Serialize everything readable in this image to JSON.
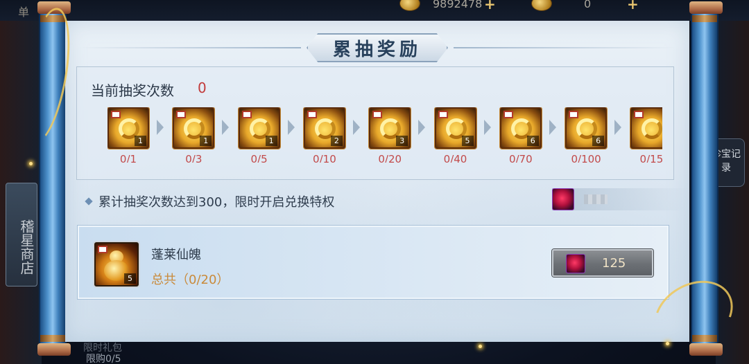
{
  "background": {
    "top_left_text": "单",
    "gold_amount": "9892478",
    "gem_amount": "0",
    "shop_label": "稽星商店",
    "side_button_label": "珍宝记录",
    "limited_label": "限时礼包",
    "limited_count": "限购0/5"
  },
  "dialog": {
    "title": "累抽奖励",
    "draw_count_label": "当前抽奖次数",
    "draw_count_value": "0",
    "milestones": [
      {
        "qty": "1",
        "progress": "0/1"
      },
      {
        "qty": "1",
        "progress": "0/3"
      },
      {
        "qty": "1",
        "progress": "0/5"
      },
      {
        "qty": "2",
        "progress": "0/10"
      },
      {
        "qty": "3",
        "progress": "0/20"
      },
      {
        "qty": "5",
        "progress": "0/40"
      },
      {
        "qty": "6",
        "progress": "0/70"
      },
      {
        "qty": "6",
        "progress": "0/100"
      },
      {
        "qty": "",
        "progress": "0/15"
      }
    ],
    "notice": "累计抽奖次数达到300，限时开启兑换特权",
    "reward": {
      "name": "蓬莱仙魄",
      "qty": "5",
      "total": "总共（0/20）",
      "price": "125"
    }
  },
  "colors": {
    "accent_red": "#c23b3b",
    "progress_red": "#c24a4a",
    "total_orange": "#c98a3a",
    "rod_blue": "#4f93cd"
  }
}
